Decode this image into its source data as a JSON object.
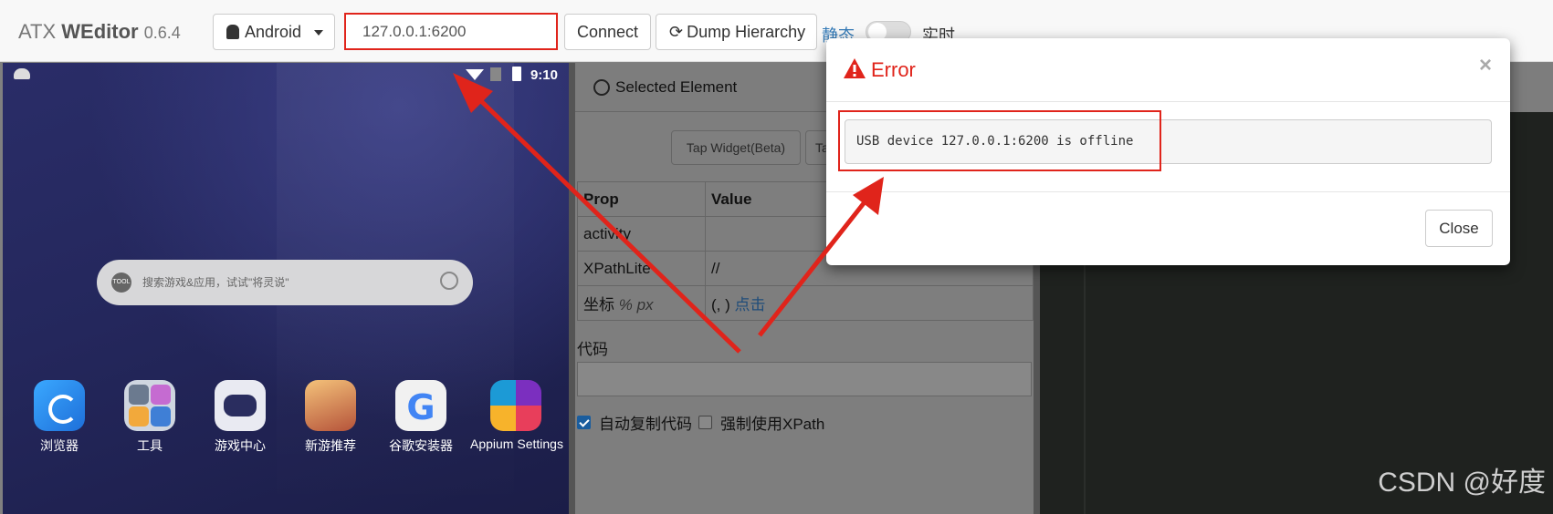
{
  "header": {
    "brand_prefix": "ATX",
    "brand_name": "WEditor",
    "version": "0.6.4",
    "platform": "Android",
    "device_serial": "127.0.0.1:6200",
    "connect_label": "Connect",
    "dump_label": "Dump Hierarchy",
    "mode_static": "静态",
    "mode_live": "实时",
    "live_enabled": false
  },
  "phone": {
    "time": "9:10",
    "search_logo": "TOOL",
    "search_placeholder": "搜索游戏&应用，试试\"将灵说\"",
    "apps": [
      {
        "label": "浏览器",
        "icon": "browser-icon"
      },
      {
        "label": "工具",
        "icon": "tools-folder-icon"
      },
      {
        "label": "游戏中心",
        "icon": "gamepad-icon"
      },
      {
        "label": "新游推荐",
        "icon": "game-hero-icon"
      },
      {
        "label": "谷歌安装器",
        "icon": "google-icon"
      },
      {
        "label": "Appium Settings",
        "icon": "appium-icon"
      }
    ]
  },
  "inspector": {
    "title": "Selected Element",
    "tap_widget_label": "Tap Widget(Beta)",
    "tap_partial_label": "Ta",
    "table": {
      "headers": [
        "Prop",
        "Value"
      ],
      "rows": [
        {
          "prop": "activity",
          "value": ""
        },
        {
          "prop": "XPathLite",
          "value": "//"
        },
        {
          "prop": "坐标",
          "prop_unit": "% px",
          "value": "(, )",
          "value_link": "点击"
        }
      ]
    },
    "code_label": "代码",
    "code_value": "",
    "options": [
      {
        "label": "自动复制代码",
        "checked": true
      },
      {
        "label": "强制使用XPath",
        "checked": false
      }
    ]
  },
  "modal": {
    "title": "Error",
    "message": "USB device 127.0.0.1:6200 is offline",
    "close_x": "×",
    "close_button": "Close"
  },
  "watermark": "CSDN @好度",
  "colors": {
    "error_red": "#e0241b",
    "link_blue": "#337ab7",
    "phone_bg": "#24275c"
  }
}
